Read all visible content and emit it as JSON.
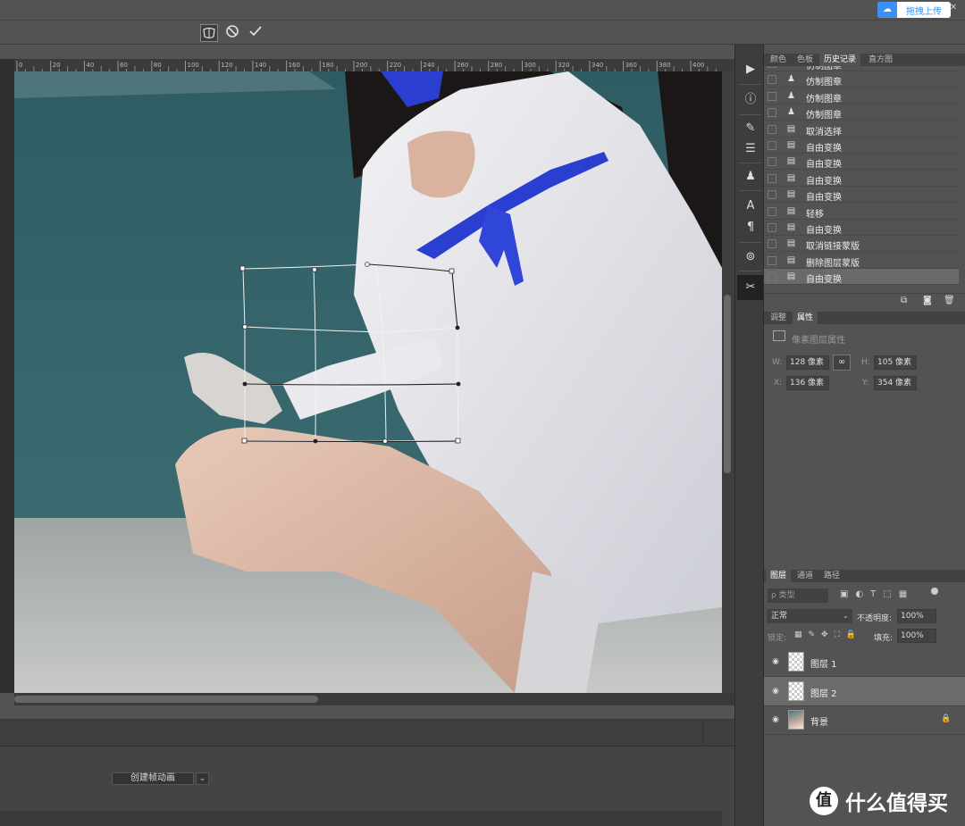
{
  "window": {
    "minimize_icon": "minimize-icon",
    "restore_icon": "restore-icon",
    "close_icon": "close-icon"
  },
  "options_bar": {
    "warp_icon": "warp-mode-icon",
    "cancel_glyph": "⃠",
    "commit_glyph": "✓"
  },
  "upload_widget": {
    "label": "拖拽上传"
  },
  "ruler_ticks": [
    "0",
    "20",
    "40",
    "60",
    "80",
    "100",
    "120",
    "140",
    "160",
    "180",
    "200",
    "220",
    "240",
    "260",
    "280",
    "300",
    "320",
    "340",
    "360",
    "380",
    "400"
  ],
  "panels": {
    "top_tabs": [
      "颜色",
      "色板",
      "历史记录",
      "直方图"
    ],
    "active_top_tab": 2,
    "history": [
      {
        "label": "仿制图章",
        "icon": "stamp"
      },
      {
        "label": "仿制图章",
        "icon": "stamp"
      },
      {
        "label": "仿制图章",
        "icon": "stamp"
      },
      {
        "label": "仿制图章",
        "icon": "stamp"
      },
      {
        "label": "取消选择",
        "icon": "doc"
      },
      {
        "label": "自由变换",
        "icon": "doc"
      },
      {
        "label": "自由变换",
        "icon": "doc"
      },
      {
        "label": "自由变换",
        "icon": "doc"
      },
      {
        "label": "自由变换",
        "icon": "doc"
      },
      {
        "label": "轻移",
        "icon": "doc"
      },
      {
        "label": "自由变换",
        "icon": "doc"
      },
      {
        "label": "取消链接蒙版",
        "icon": "doc"
      },
      {
        "label": "删除图层蒙版",
        "icon": "doc"
      },
      {
        "label": "自由变换",
        "icon": "doc"
      }
    ],
    "selected_history": 13,
    "props_tabs": [
      "调整",
      "属性"
    ],
    "active_props_tab": 1,
    "props_title": "像素图层属性",
    "props": {
      "w_label": "W:",
      "w_value": "128 像素",
      "h_label": "H:",
      "h_value": "105 像素",
      "x_label": "X:",
      "x_value": "136 像素",
      "y_label": "Y:",
      "y_value": "354 像素"
    },
    "layers_tabs": [
      "图层",
      "通道",
      "路径"
    ],
    "active_layers_tab": 0,
    "layers_search": "ρ 类型",
    "blend_mode": "正常",
    "opacity_label": "不透明度:",
    "opacity_value": "100%",
    "lock_label": "锁定:",
    "fill_label": "填充:",
    "fill_value": "100%",
    "layers": [
      {
        "name": "图层 1",
        "visible": true
      },
      {
        "name": "图层 2",
        "visible": true
      },
      {
        "name": "背景",
        "visible": true,
        "locked": true
      }
    ],
    "selected_layer": 1
  },
  "timeline": {
    "create_button": "创建帧动画"
  },
  "watermark": {
    "logo_glyph": "值",
    "text": "什么值得买"
  },
  "colors": {
    "accent_blue": "#3b8ff5",
    "panel_bg": "#535353",
    "dark_bg": "#3d3d3d"
  }
}
